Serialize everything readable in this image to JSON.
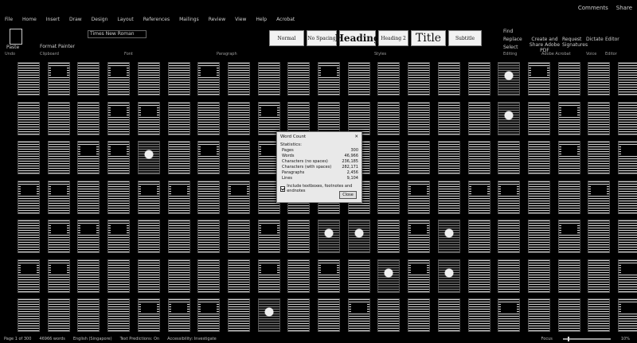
{
  "menu": [
    "File",
    "Home",
    "Insert",
    "Draw",
    "Design",
    "Layout",
    "References",
    "Mailings",
    "Review",
    "View",
    "Help",
    "Acrobat"
  ],
  "title_right": {
    "comments": "Comments",
    "share": "Share"
  },
  "ribbon": {
    "paste_label": "Paste",
    "format_painter": "Format Painter",
    "font_name": "Times New Roman",
    "styles": [
      "Normal",
      "No Spacing",
      "Heading",
      "Heading 2",
      "Title",
      "Subtitle"
    ],
    "find": "Find",
    "replace": "Replace",
    "select": "Select",
    "create_share": "Create and Share Adobe PDF",
    "request_sign": "Request Signatures",
    "dictate": "Dictate",
    "editor": "Editor",
    "group_labels": [
      "Undo",
      "Clipboard",
      "Font",
      "Paragraph",
      "Styles",
      "Editing",
      "Adobe Acrobat",
      "Voice",
      "Editor"
    ]
  },
  "dialog": {
    "title": "Word Count",
    "section": "Statistics:",
    "rows": [
      {
        "label": "Pages",
        "value": "300"
      },
      {
        "label": "Words",
        "value": "46,966"
      },
      {
        "label": "Characters (no spaces)",
        "value": "236,185"
      },
      {
        "label": "Characters (with spaces)",
        "value": "282,171"
      },
      {
        "label": "Paragraphs",
        "value": "2,456"
      },
      {
        "label": "Lines",
        "value": "9,104"
      }
    ],
    "checkbox_label": "Include textboxes, footnotes and endnotes",
    "close_label": "Close"
  },
  "status": {
    "page": "Page 1 of 300",
    "words": "46966 words",
    "language": "English (Singapore)",
    "predictions": "Text Predictions: On",
    "accessibility": "Accessibility: Investigate",
    "focus": "Focus",
    "zoom": "10%"
  }
}
